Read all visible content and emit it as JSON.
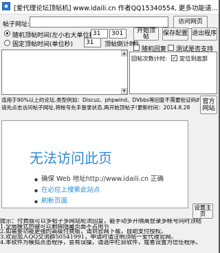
{
  "window": {
    "title": "[爱代理论坛顶帖机] www.idaili.cn  作者QQ15340554, 更多功能请..."
  },
  "post_url": {
    "label": "帖子网址:",
    "value": "",
    "visit_button": "访问网页"
  },
  "mode": {
    "random_label": "随机顶帖时间(左小右大单位秒)",
    "random_min": "31",
    "random_max": "301",
    "fixed_label": "固定顶帖时间(单位秒)",
    "fixed_value": "31",
    "countdown_label": "顶帖倒计时",
    "countdown_unit": "秒"
  },
  "actions": {
    "start": "开始顶帖",
    "save": "保存配置",
    "exit": "退出程序"
  },
  "options": {
    "random_reply": "随机回复",
    "test_proxy": "测试是否支持"
  },
  "status": {
    "reply_count_label": "回帖次数计时:",
    "locate_bottom": "定位到底部"
  },
  "info": {
    "line1": "适用于90%以上的论坛.类型例如：Discuz、phpwind、DVbbs等回复不需要验证码的论坛!",
    "line2": "请先点击访问帖子网址,将帐号先手登录状态,再开始顶帖子!更新时间：2014.8.28",
    "website_button": "官方\n网站"
  },
  "browser": {
    "error_title": "无法访问此页",
    "line1": "确保 Web 地址http://www.idaili.cn 正确",
    "line2": "在必应上搜索此站点",
    "line3": "刷新页面"
  },
  "settings_button": "设置主页",
  "tips": {
    "line1": "提示：付费版可以多帖子多网站轮流回复，能手动多开隔离登录多帐号同时顶帖",
    "line2": "1.全局模式热键可以删除隐藏页面不占用节",
    "line3": "2.如需要功能更强的高级付费版，请到官网下载，自助支付授权。",
    "line4": "3.欢迎加入QQ交流群50541991，申请时请注明顶帖一爱代理官网。",
    "line5": "4.本软件为模拟点击程序，会有误操，请选中栏目软件，或者设置为信任程序。"
  },
  "colors": {
    "accent": "#2b8ad6",
    "window_bg": "#f0f0f0"
  }
}
